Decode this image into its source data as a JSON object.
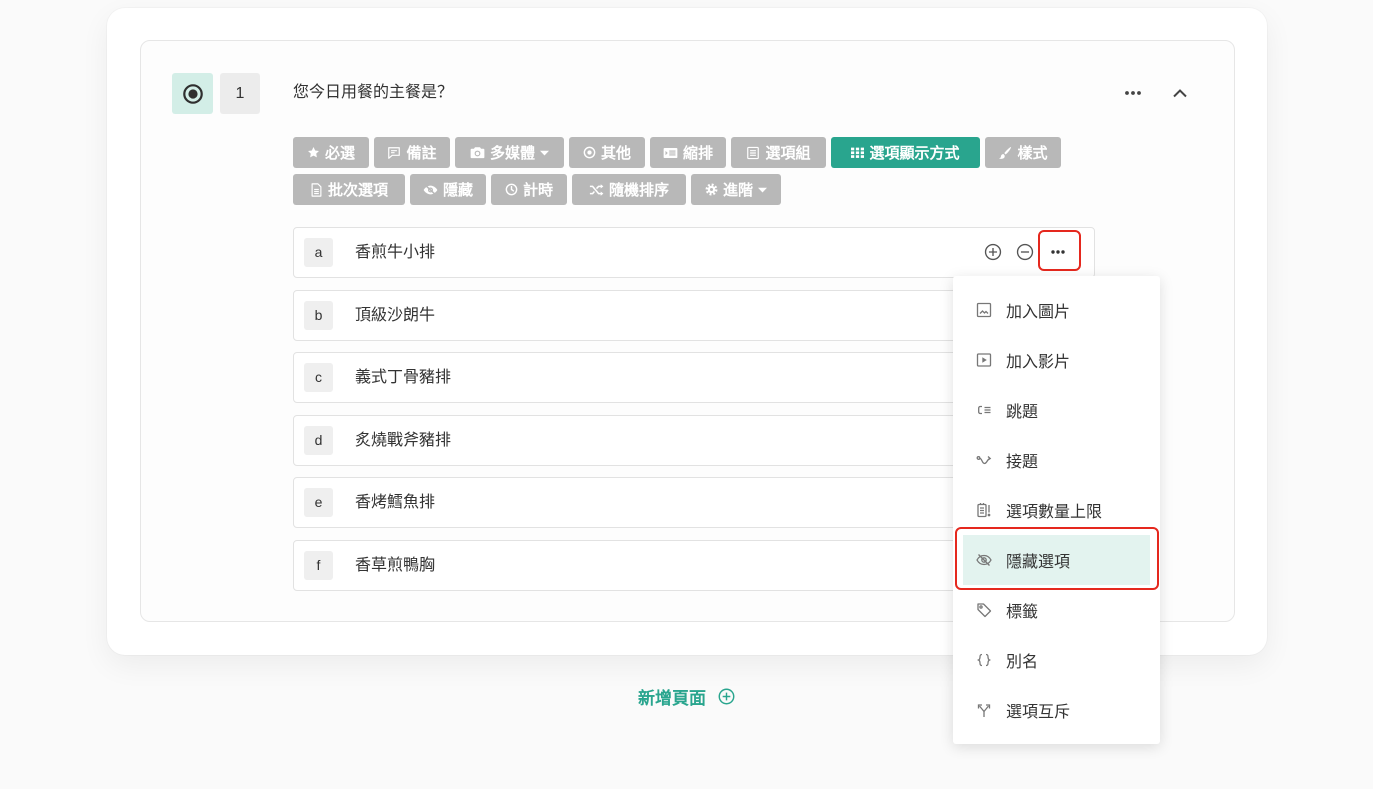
{
  "question": {
    "type_icon": "radio-selected-icon",
    "number": "1",
    "title": "您今日用餐的主餐是？",
    "more_icon": "more-horizontal-icon",
    "collapse_icon": "chevron-up-icon"
  },
  "toolbar": {
    "row1": [
      {
        "label": "必選",
        "icon": "star-icon"
      },
      {
        "label": "備註",
        "icon": "comment-icon"
      },
      {
        "label": "多媒體",
        "icon": "camera-icon",
        "dropdown": true
      },
      {
        "label": "其他",
        "icon": "radio-icon"
      },
      {
        "label": "縮排",
        "icon": "indent-icon"
      },
      {
        "label": "選項組",
        "icon": "list-group-icon"
      },
      {
        "label": "選項顯示方式",
        "icon": "grid-icon",
        "active": true
      },
      {
        "label": "樣式",
        "icon": "brush-icon"
      }
    ],
    "row2": [
      {
        "label": "批次選項",
        "icon": "document-icon"
      },
      {
        "label": "隱藏",
        "icon": "eye-slash-icon"
      },
      {
        "label": "計時",
        "icon": "clock-icon"
      },
      {
        "label": "隨機排序",
        "icon": "shuffle-icon"
      },
      {
        "label": "進階",
        "icon": "gear-icon",
        "dropdown": true
      }
    ]
  },
  "options": [
    {
      "letter": "a",
      "text": "香煎牛小排"
    },
    {
      "letter": "b",
      "text": "頂級沙朗牛"
    },
    {
      "letter": "c",
      "text": "義式丁骨豬排"
    },
    {
      "letter": "d",
      "text": "炙燒戰斧豬排"
    },
    {
      "letter": "e",
      "text": "香烤鱈魚排"
    },
    {
      "letter": "f",
      "text": "香草煎鴨胸"
    }
  ],
  "option_actions": {
    "add_icon": "plus-circle-icon",
    "remove_icon": "minus-circle-icon",
    "more_icon": "more-horizontal-icon"
  },
  "option_menu": {
    "items": [
      {
        "label": "加入圖片",
        "icon": "image-icon"
      },
      {
        "label": "加入影片",
        "icon": "video-icon"
      },
      {
        "label": "跳題",
        "icon": "skip-logic-icon"
      },
      {
        "label": "接題",
        "icon": "follow-up-icon"
      },
      {
        "label": "選項數量上限",
        "icon": "option-limit-icon"
      },
      {
        "label": "隱藏選項",
        "icon": "eye-off-icon",
        "highlighted": true
      },
      {
        "label": "標籤",
        "icon": "tag-icon"
      },
      {
        "label": "別名",
        "icon": "braces-icon"
      },
      {
        "label": "選項互斥",
        "icon": "fork-icon"
      }
    ]
  },
  "add_page": {
    "label": "新增頁面",
    "icon": "plus-circle-icon"
  },
  "colors": {
    "accent": "#29a58e",
    "toolbar_button": "#b8b8b8",
    "question_type_bg": "#d3eee7",
    "menu_highlight_bg": "#e3f3ef",
    "annotation_outline": "#e5281e"
  }
}
